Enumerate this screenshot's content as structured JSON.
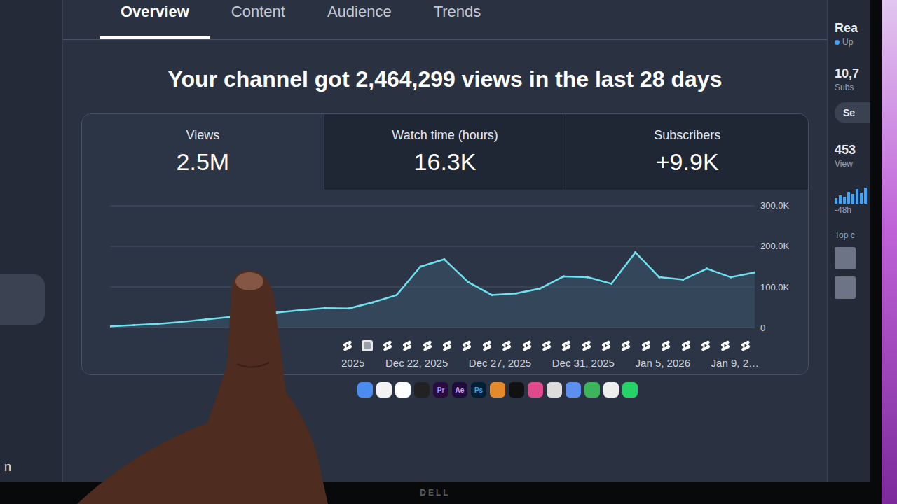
{
  "tabs": [
    {
      "label": "Overview",
      "selected": true
    },
    {
      "label": "Content",
      "selected": false
    },
    {
      "label": "Audience",
      "selected": false
    },
    {
      "label": "Trends",
      "selected": false
    }
  ],
  "headline": "Your channel got 2,464,299 views in the last 28 days",
  "metrics": [
    {
      "label": "Views",
      "value": "2.5M",
      "selected": true
    },
    {
      "label": "Watch time (hours)",
      "value": "16.3K",
      "selected": false
    },
    {
      "label": "Subscribers",
      "value": "+9.9K",
      "selected": false
    }
  ],
  "chart": {
    "y_ticks": [
      "300.0K",
      "200.0K",
      "100.0K",
      "0"
    ],
    "x_labels": [
      "2025",
      "Dec 22, 2025",
      "Dec 27, 2025",
      "Dec 31, 2025",
      "Jan 5, 2026",
      "Jan 9, 2…"
    ],
    "views": [
      3000,
      6000,
      9000,
      14000,
      20000,
      26000,
      31000,
      37000,
      43000,
      48000,
      47000,
      62000,
      80000,
      150000,
      168000,
      112000,
      80000,
      84000,
      96000,
      126000,
      124000,
      108000,
      185000,
      124000,
      118000,
      145000,
      124000,
      136000
    ],
    "uploads": [
      {
        "kind": "short"
      },
      {
        "kind": "video"
      },
      {
        "kind": "short"
      },
      {
        "kind": "short"
      },
      {
        "kind": "short"
      },
      {
        "kind": "short"
      },
      {
        "kind": "short"
      },
      {
        "kind": "short"
      },
      {
        "kind": "short"
      },
      {
        "kind": "short"
      },
      {
        "kind": "short"
      },
      {
        "kind": "short"
      },
      {
        "kind": "short"
      },
      {
        "kind": "short"
      },
      {
        "kind": "short"
      },
      {
        "kind": "short"
      },
      {
        "kind": "short"
      },
      {
        "kind": "short"
      },
      {
        "kind": "short"
      },
      {
        "kind": "short"
      },
      {
        "kind": "short"
      }
    ]
  },
  "sidebar": {
    "highlight": true,
    "footer": "n"
  },
  "realtime": {
    "title": "Rea",
    "status": "Up",
    "subscribers": "10,7",
    "subscribers_label": "Subs",
    "button": "Se",
    "views": "453",
    "views_label": "View",
    "bars": [
      {
        "level": 0.3
      },
      {
        "level": 0.45
      },
      {
        "level": 0.4
      },
      {
        "level": 0.65
      },
      {
        "level": 0.55
      },
      {
        "level": 0.8
      },
      {
        "level": 0.6
      },
      {
        "level": 0.9
      }
    ],
    "range": "-48h",
    "top_label": "Top c"
  },
  "dock": {
    "apps": [
      {
        "label": "",
        "color": "#4a8cf0"
      },
      {
        "label": "",
        "color": "#f2f2f2"
      },
      {
        "label": "",
        "color": "#ffffff"
      },
      {
        "label": "",
        "color": "#222222"
      },
      {
        "label": "Pr",
        "color": "#2a0b3f"
      },
      {
        "label": "Ae",
        "color": "#1f0b3d"
      },
      {
        "label": "Ps",
        "color": "#001e36"
      },
      {
        "label": "",
        "color": "#e58a2b"
      },
      {
        "label": "",
        "color": "#111111"
      },
      {
        "label": "",
        "color": "#e04a8a"
      },
      {
        "label": "",
        "color": "#dcdcdc"
      },
      {
        "label": "",
        "color": "#5b8ff0"
      },
      {
        "label": "",
        "color": "#3bb45a"
      },
      {
        "label": "",
        "color": "#eeeeee"
      },
      {
        "label": "",
        "color": "#25d366"
      }
    ]
  },
  "monitor": {
    "brand": "DELL"
  }
}
